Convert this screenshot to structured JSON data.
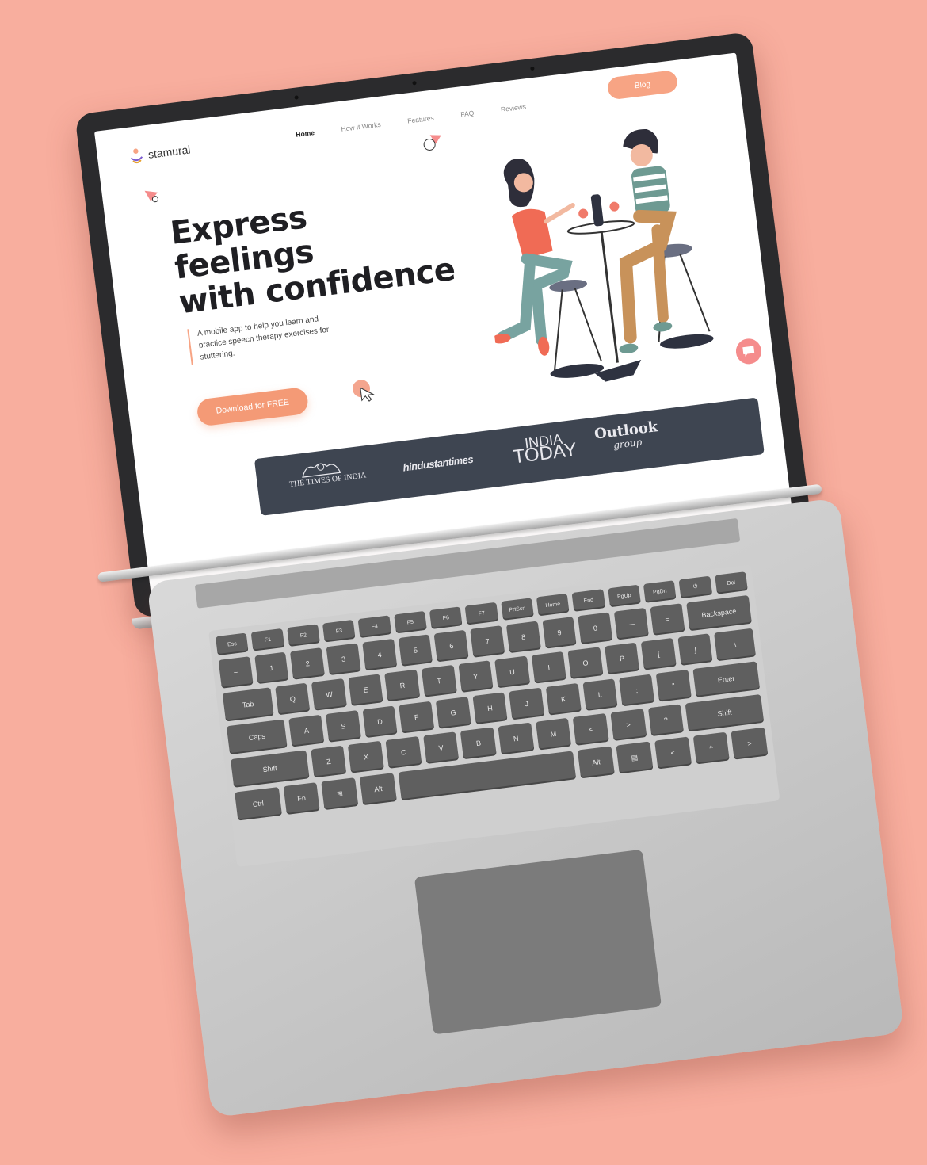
{
  "colors": {
    "background": "#F8AE9E",
    "accent": "#F7A484",
    "dark_bar": "#3e4551"
  },
  "site": {
    "logo": "stamurai",
    "menu": [
      "Home",
      "How It Works",
      "Features",
      "FAQ",
      "Reviews"
    ],
    "blog_button": "Blog",
    "headline_line1": "Express feelings",
    "headline_line2": "with confidence",
    "subtext": "A mobile app to help you learn and practice speech therapy exercises for stuttering.",
    "download_button": "Download for FREE",
    "press": {
      "toi": "THE TIMES OF INDIA",
      "ht": "hindustantimes",
      "it_line1": "INDIA",
      "it_line2": "TODAY",
      "og_line1": "Outlook",
      "og_line2": "group"
    },
    "icons": {
      "chat": "chat-bubble-icon",
      "cursor": "cursor-arrow-icon",
      "logo": "stamurai-logo-icon"
    }
  },
  "keyboard": {
    "fn_row": [
      "Esc",
      "F1",
      "F2",
      "F3",
      "F4",
      "F5",
      "F6",
      "F7",
      "PrtScn",
      "Home",
      "End",
      "PgUp",
      "PgDn",
      "⏻",
      "Del"
    ],
    "row1": [
      "~",
      "1",
      "2",
      "3",
      "4",
      "5",
      "6",
      "7",
      "8",
      "9",
      "0",
      "—",
      "=",
      "Backspace"
    ],
    "row2": [
      "Tab",
      "Q",
      "W",
      "E",
      "R",
      "T",
      "Y",
      "U",
      "I",
      "O",
      "P",
      "[",
      "]",
      "\\"
    ],
    "row3": [
      "Caps",
      "A",
      "S",
      "D",
      "F",
      "G",
      "H",
      "J",
      "K",
      "L",
      ";",
      "\"",
      "Enter"
    ],
    "row4": [
      "Shift",
      "Z",
      "X",
      "C",
      "V",
      "B",
      "N",
      "M",
      "<",
      ">",
      "?",
      "Shift"
    ],
    "row5": [
      "Ctrl",
      "Fn",
      "⊞",
      "Alt",
      "",
      "Alt",
      "▤",
      "<",
      "^",
      ">"
    ]
  }
}
